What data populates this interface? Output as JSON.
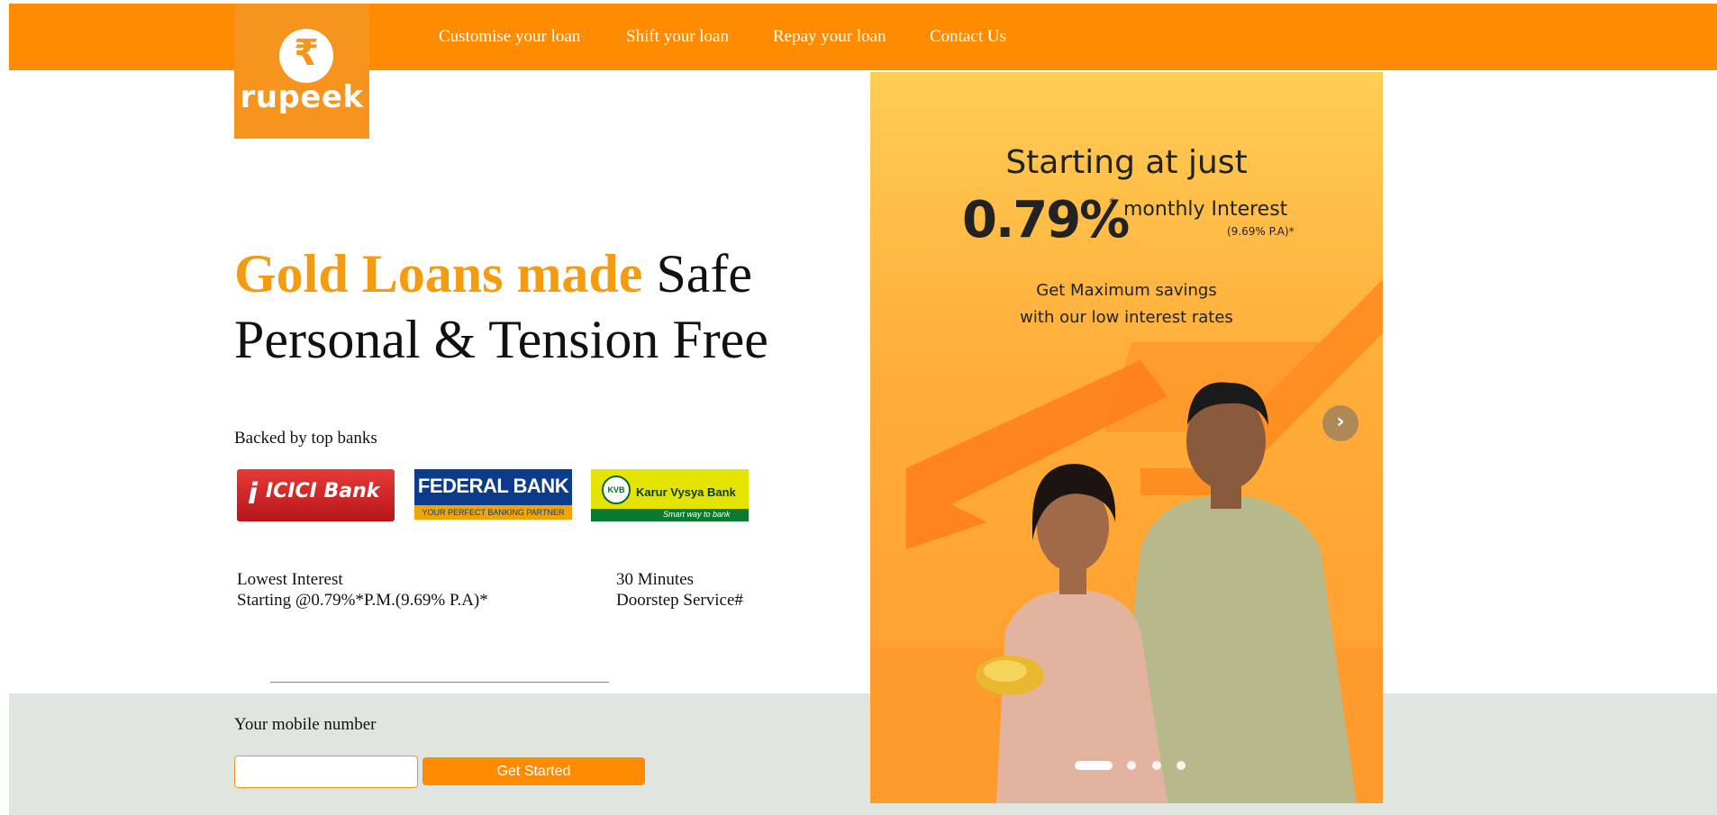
{
  "brand": {
    "name": "rupeek",
    "symbol": "₹",
    "color": "#ff8c00"
  },
  "nav": [
    {
      "label": "Customise your loan"
    },
    {
      "label": "Shift your loan"
    },
    {
      "label": "Repay your loan"
    },
    {
      "label": "Contact Us"
    }
  ],
  "hero": {
    "highlight": "Gold Loans made",
    "rest_line1": "Safe",
    "line2": "Personal & Tension Free",
    "highlight_color": "#f39c12"
  },
  "banks": {
    "label": "Backed by top banks",
    "items": [
      {
        "name": "ICICI Bank",
        "mark": "i",
        "text": "ICICI Bank"
      },
      {
        "name": "FEDERAL BANK",
        "tagline": "YOUR PERFECT BANKING PARTNER"
      },
      {
        "name": "Karur Vysya Bank",
        "badge": "KVB",
        "tagline": "Smart way to bank"
      }
    ]
  },
  "features": [
    {
      "line1": "Lowest Interest",
      "line2": "Starting @0.79%*P.M.(9.69% P.A)*"
    },
    {
      "line1": "30 Minutes",
      "line2": "Doorstep Service#"
    }
  ],
  "signup": {
    "label": "Your mobile number",
    "input_value": "",
    "button": "Get Started"
  },
  "banner": {
    "heading": "Starting at just",
    "rate": "0.79%",
    "star": "*",
    "monthly": "monthly Interest",
    "pa": "(9.69% P.A)*",
    "sub_line1": "Get Maximum savings",
    "sub_line2": "with our low interest rates",
    "next_icon": "chevron-right-icon",
    "slides_count": 4,
    "active_slide": 1
  }
}
